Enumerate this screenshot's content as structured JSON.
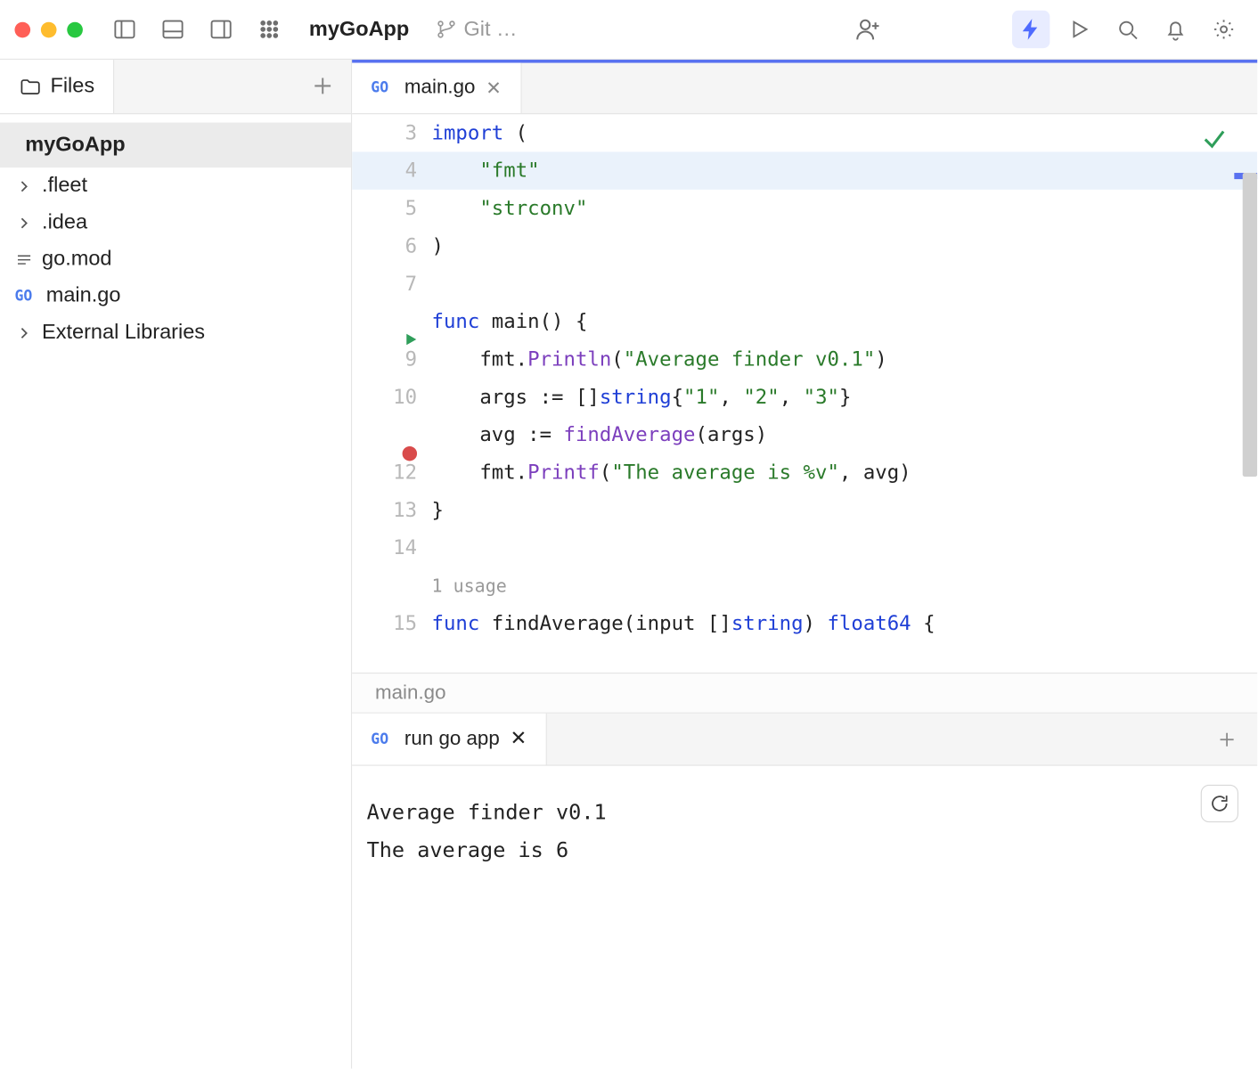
{
  "toolbar": {
    "project": "myGoApp",
    "git_label": "Git …"
  },
  "sidebar": {
    "tab": "Files",
    "project": "myGoApp",
    "items": [
      {
        "kind": "folder",
        "label": ".fleet"
      },
      {
        "kind": "folder",
        "label": ".idea"
      },
      {
        "kind": "file-lines",
        "label": "go.mod"
      },
      {
        "kind": "go",
        "label": "main.go"
      },
      {
        "kind": "folder",
        "label": "External Libraries"
      }
    ]
  },
  "editor": {
    "tab": {
      "badge": "GO",
      "name": "main.go"
    },
    "lines": [
      {
        "n": "3",
        "hl": false,
        "gutter": "num",
        "tokens": [
          [
            "kw",
            "import"
          ],
          [
            "",
            " ("
          ]
        ]
      },
      {
        "n": "4",
        "hl": true,
        "gutter": "num",
        "tokens": [
          [
            "",
            "    "
          ],
          [
            "str",
            "\"fmt\""
          ]
        ]
      },
      {
        "n": "5",
        "hl": false,
        "gutter": "num",
        "tokens": [
          [
            "",
            "    "
          ],
          [
            "str",
            "\"strconv\""
          ]
        ]
      },
      {
        "n": "6",
        "hl": false,
        "gutter": "num",
        "tokens": [
          [
            "",
            ")"
          ]
        ]
      },
      {
        "n": "7",
        "hl": false,
        "gutter": "num",
        "tokens": []
      },
      {
        "n": "",
        "hl": false,
        "gutter": "run",
        "tokens": [
          [
            "kw",
            "func"
          ],
          [
            "",
            " main() {"
          ]
        ]
      },
      {
        "n": "9",
        "hl": false,
        "gutter": "num",
        "tokens": [
          [
            "",
            "    fmt."
          ],
          [
            "fn",
            "Println"
          ],
          [
            "",
            "("
          ],
          [
            "str",
            "\"Average finder v0.1\""
          ],
          [
            "",
            ")"
          ]
        ]
      },
      {
        "n": "10",
        "hl": false,
        "gutter": "num",
        "tokens": [
          [
            "",
            "    args := []"
          ],
          [
            "ty",
            "string"
          ],
          [
            "",
            "{"
          ],
          [
            "str",
            "\"1\""
          ],
          [
            "",
            ", "
          ],
          [
            "str",
            "\"2\""
          ],
          [
            "",
            ", "
          ],
          [
            "str",
            "\"3\""
          ],
          [
            "",
            "}"
          ]
        ]
      },
      {
        "n": "",
        "hl": false,
        "gutter": "bp",
        "tokens": [
          [
            "",
            "    avg := "
          ],
          [
            "fn",
            "findAverage"
          ],
          [
            "",
            "(args)"
          ]
        ]
      },
      {
        "n": "12",
        "hl": false,
        "gutter": "num",
        "tokens": [
          [
            "",
            "    fmt."
          ],
          [
            "fn",
            "Printf"
          ],
          [
            "",
            "("
          ],
          [
            "str",
            "\"The average is %v\""
          ],
          [
            "",
            ", avg)"
          ]
        ]
      },
      {
        "n": "13",
        "hl": false,
        "gutter": "num",
        "tokens": [
          [
            "",
            "}"
          ]
        ]
      },
      {
        "n": "14",
        "hl": false,
        "gutter": "num",
        "tokens": []
      },
      {
        "n": "",
        "hl": false,
        "gutter": "",
        "tokens": [
          [
            "usage",
            "1 usage"
          ]
        ]
      },
      {
        "n": "15",
        "hl": false,
        "gutter": "num",
        "tokens": [
          [
            "kw",
            "func"
          ],
          [
            "",
            " findAverage(input []"
          ],
          [
            "ty",
            "string"
          ],
          [
            "",
            ") "
          ],
          [
            "ty",
            "float64"
          ],
          [
            "",
            " {"
          ]
        ]
      }
    ],
    "breadcrumb": "main.go"
  },
  "run": {
    "tab": {
      "badge": "GO",
      "name": "run go app"
    },
    "output": [
      "Average finder v0.1",
      "The average is 6"
    ]
  }
}
